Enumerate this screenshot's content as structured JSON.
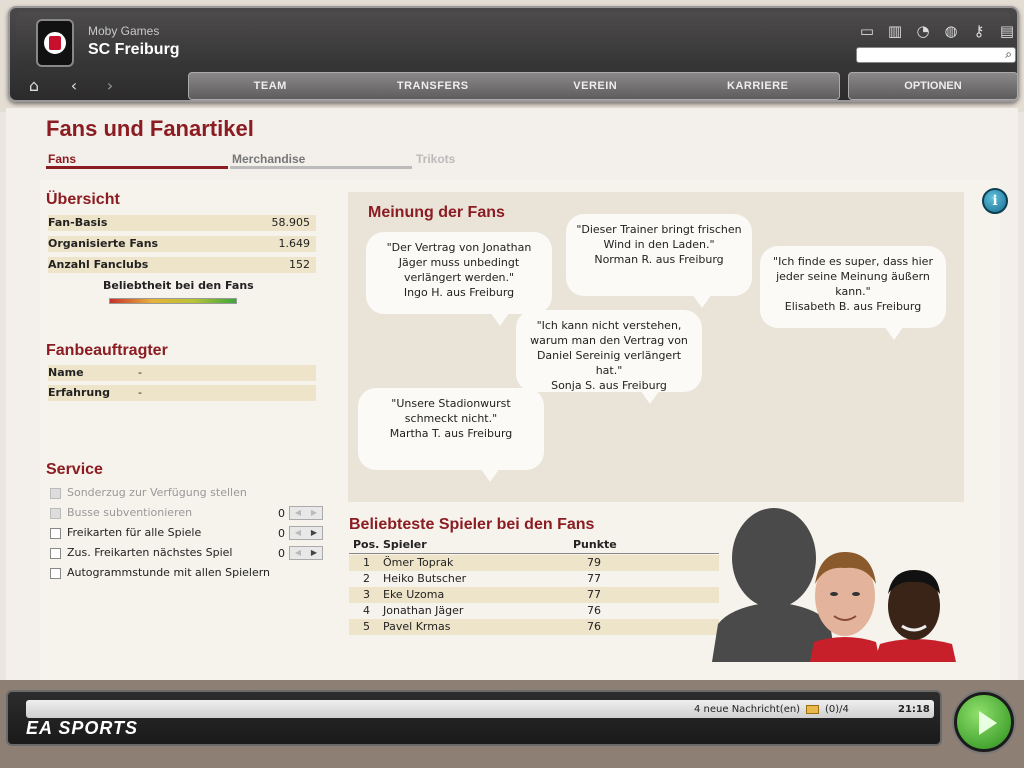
{
  "header": {
    "owner": "Moby Games",
    "club": "SC Freiburg",
    "tool_icons": [
      "window-icon",
      "stats-icon",
      "spinner-icon",
      "globe-icon",
      "keys-icon",
      "document-search-icon"
    ],
    "search_placeholder": ""
  },
  "nav": {
    "tabs": [
      "TEAM",
      "TRANSFERS",
      "VEREIN",
      "KARRIERE"
    ],
    "optionen": "OPTIONEN"
  },
  "page": {
    "title": "Fans und Fanartikel",
    "subtabs": [
      {
        "label": "Fans",
        "state": "active"
      },
      {
        "label": "Merchandise",
        "state": "normal"
      },
      {
        "label": "Trikots",
        "state": "disabled"
      }
    ]
  },
  "overview": {
    "title": "Übersicht",
    "rows": [
      {
        "label": "Fan-Basis",
        "value": "58.905"
      },
      {
        "label": "Organisierte Fans",
        "value": "1.649"
      },
      {
        "label": "Anzahl Fanclubs",
        "value": "152"
      }
    ],
    "popularity_label": "Beliebtheit bei den Fans"
  },
  "fanbeauftragter": {
    "title": "Fanbeauftragter",
    "rows": [
      {
        "label": "Name",
        "value": "-"
      },
      {
        "label": "Erfahrung",
        "value": "-"
      }
    ]
  },
  "service": {
    "title": "Service",
    "items": [
      {
        "label": "Sonderzug zur Verfügung stellen",
        "enabled": false,
        "count": "",
        "spinner": false
      },
      {
        "label": "Busse subventionieren",
        "enabled": false,
        "count": "0",
        "spinner": true
      },
      {
        "label": "Freikarten für alle Spiele",
        "enabled": true,
        "count": "0",
        "spinner": true
      },
      {
        "label": "Zus. Freikarten nächstes Spiel",
        "enabled": true,
        "count": "0",
        "spinner": true
      },
      {
        "label": "Autogrammstunde mit allen Spielern",
        "enabled": true,
        "count": "",
        "spinner": false
      }
    ]
  },
  "opinions": {
    "title": "Meinung der Fans",
    "quotes": [
      {
        "text": "\"Der Vertrag von Jonathan Jäger muss unbedingt verlängert werden.\"",
        "author": "Ingo H. aus Freiburg"
      },
      {
        "text": "\"Dieser Trainer bringt frischen Wind in den Laden.\"",
        "author": "Norman R. aus Freiburg"
      },
      {
        "text": "\"Ich finde es super, dass hier jeder seine Meinung äußern kann.\"",
        "author": "Elisabeth B. aus Freiburg"
      },
      {
        "text": "\"Ich kann nicht verstehen, warum man den Vertrag von Daniel Sereinig verlängert hat.\"",
        "author": "Sonja S. aus Freiburg"
      },
      {
        "text": "\"Unsere Stadionwurst schmeckt nicht.\"",
        "author": "Martha T. aus Freiburg"
      }
    ]
  },
  "players": {
    "title": "Beliebteste Spieler bei den Fans",
    "columns": [
      "Pos.",
      "Spieler",
      "Punkte"
    ],
    "rows": [
      {
        "pos": "1",
        "name": "Ömer Toprak",
        "points": "79"
      },
      {
        "pos": "2",
        "name": "Heiko Butscher",
        "points": "77"
      },
      {
        "pos": "3",
        "name": "Eke Uzoma",
        "points": "77"
      },
      {
        "pos": "4",
        "name": "Jonathan Jäger",
        "points": "76"
      },
      {
        "pos": "5",
        "name": "Pavel Krmas",
        "points": "76"
      }
    ]
  },
  "statusbar": {
    "news": "4 neue Nachricht(en)",
    "mail_count": "(0)/4",
    "time": "21:18",
    "brand": "EA SPORTS"
  },
  "colors": {
    "accent": "#8b1c22",
    "row_bg": "#ede4c9",
    "play_button": "#2a8e1c"
  }
}
